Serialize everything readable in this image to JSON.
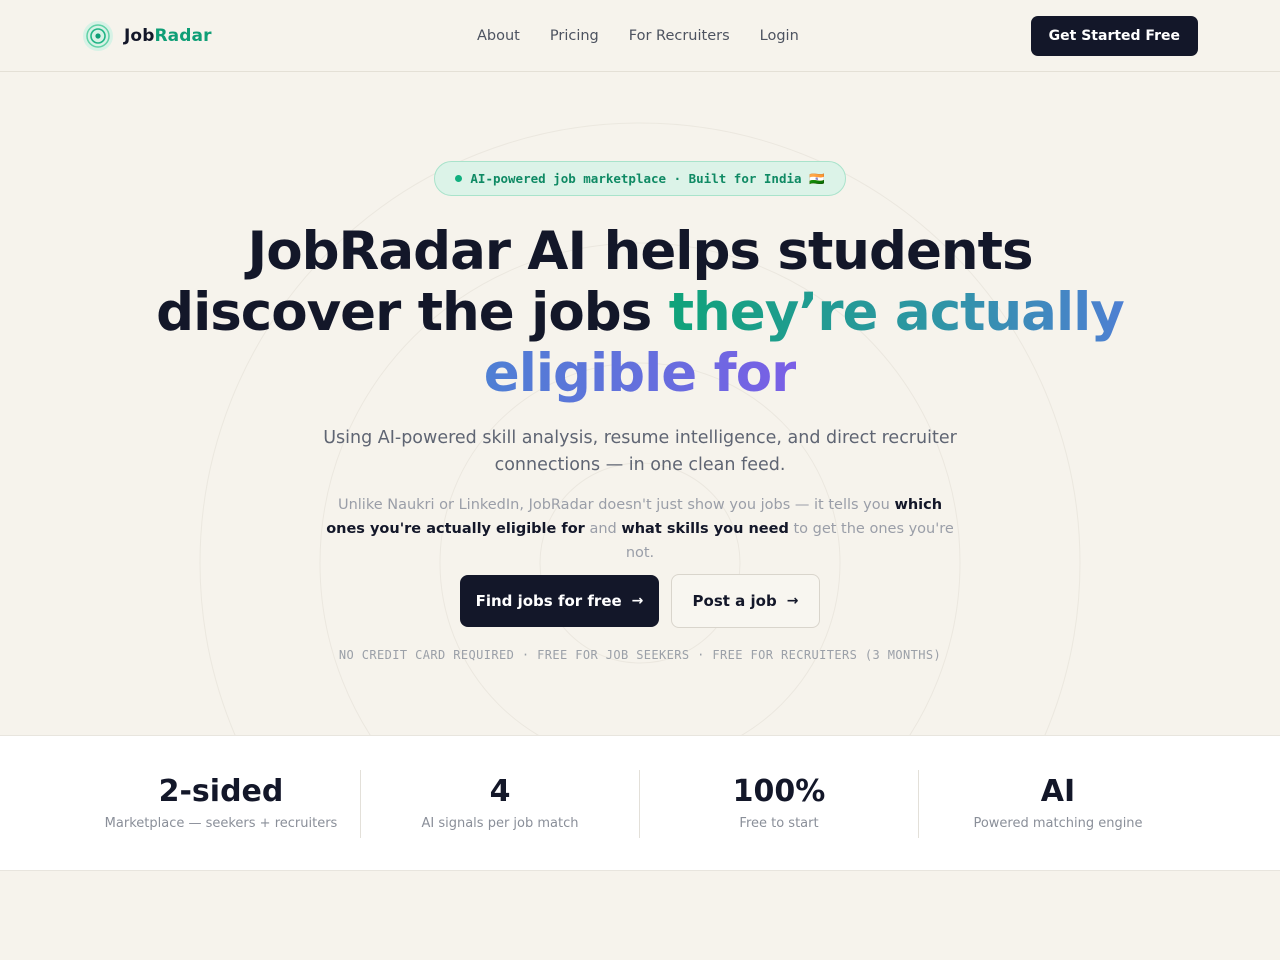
{
  "nav": {
    "logo_part1": "Job",
    "logo_part2": "Radar",
    "logo_icon": "radar-icon",
    "links": [
      "About",
      "Pricing",
      "For Recruiters",
      "Login"
    ],
    "cta_label": "Get Started Free"
  },
  "hero": {
    "badge": "AI-powered job marketplace · Built for India 🇮🇳",
    "headline_plain": "JobRadar AI helps students discover the jobs ",
    "headline_gradient": "they’re actually eligible for",
    "subtitle": "Using AI-powered skill analysis, resume intelligence, and direct recruiter connections — in one clean feed.",
    "desc_1": "Unlike Naukri or LinkedIn, JobRadar doesn't just show you jobs — it tells you ",
    "desc_2": "which ones you're actually eligible for",
    "desc_3": " and ",
    "desc_4": "what skills you need",
    "desc_5": " to get the ones you're not.",
    "primary_cta": "Find jobs for free",
    "secondary_cta": "Post a job",
    "arrow": "→",
    "fineprint": "NO CREDIT CARD REQUIRED · FREE FOR JOB SEEKERS · FREE FOR RECRUITERS (3 MONTHS)"
  },
  "stats": [
    {
      "value": "2-sided",
      "label": "Marketplace — seekers + recruiters"
    },
    {
      "value": "4",
      "label": "AI signals per job match"
    },
    {
      "value": "100%",
      "label": "Free to start"
    },
    {
      "value": "AI",
      "label": "Powered matching engine"
    }
  ],
  "colors": {
    "background": "#f6f3ec",
    "dark": "#131729",
    "accent_green": "#0f9e76",
    "accent_purple": "#7a5fe6"
  }
}
